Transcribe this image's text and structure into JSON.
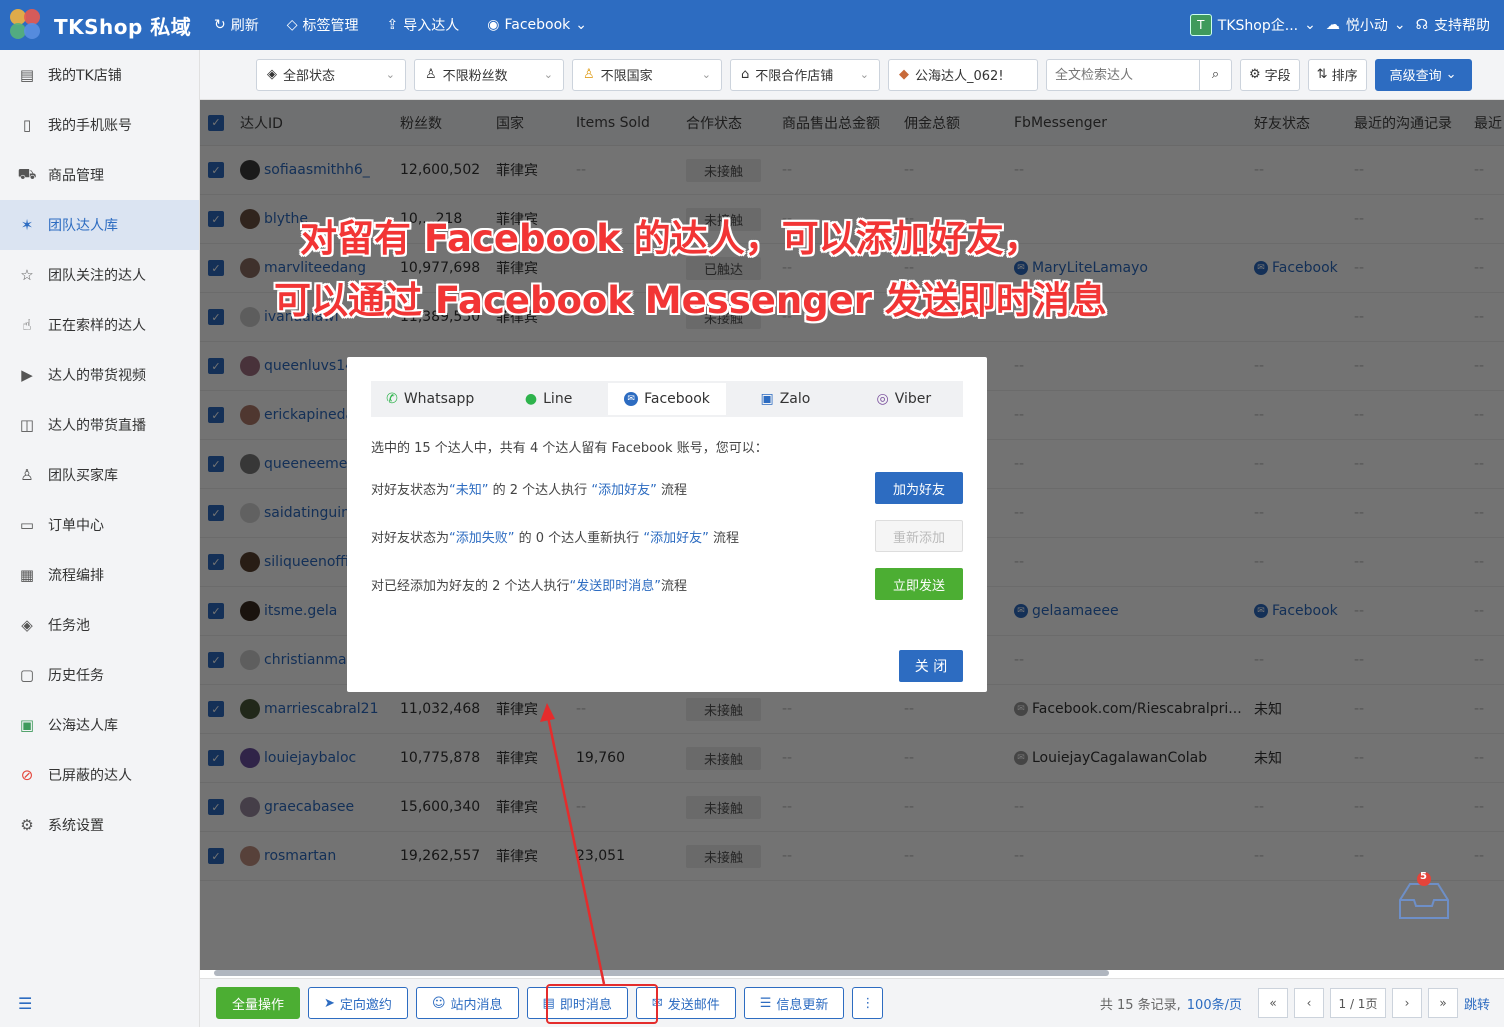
{
  "topbar": {
    "brand": "TKShop 私域",
    "nav": [
      "刷新",
      "标签管理",
      "导入达人",
      "Facebook"
    ],
    "company": "TKShop企...",
    "user": "悦小动",
    "help": "支持帮助",
    "company_initial": "T"
  },
  "sidebar": {
    "items": [
      {
        "label": "我的TK店铺",
        "icon": "shop-icon"
      },
      {
        "label": "我的手机账号",
        "icon": "phone-icon"
      },
      {
        "label": "商品管理",
        "icon": "cart-icon"
      },
      {
        "label": "团队达人库",
        "icon": "star-people-icon"
      },
      {
        "label": "团队关注的达人",
        "icon": "star-icon"
      },
      {
        "label": "正在索样的达人",
        "icon": "hand-icon"
      },
      {
        "label": "达人的带货视频",
        "icon": "video-icon"
      },
      {
        "label": "达人的带货直播",
        "icon": "live-icon"
      },
      {
        "label": "团队买家库",
        "icon": "buyer-icon"
      },
      {
        "label": "订单中心",
        "icon": "order-icon"
      },
      {
        "label": "流程编排",
        "icon": "calendar-icon"
      },
      {
        "label": "任务池",
        "icon": "layers-icon"
      },
      {
        "label": "历史任务",
        "icon": "clipboard-icon"
      },
      {
        "label": "公海达人库",
        "icon": "public-icon"
      },
      {
        "label": "已屏蔽的达人",
        "icon": "block-icon"
      },
      {
        "label": "系统设置",
        "icon": "gear-icon"
      }
    ],
    "active_index": 3
  },
  "filters": {
    "status": "全部状态",
    "fans": "不限粉丝数",
    "country": "不限国家",
    "shop": "不限合作店铺",
    "pool": "公海达人_062!",
    "search_placeholder": "全文检索达人",
    "fields": "字段",
    "sort": "排序",
    "advanced": "高级查询"
  },
  "table": {
    "headers": [
      "达人ID",
      "粉丝数",
      "国家",
      "Items Sold",
      "合作状态",
      "商品售出总金额",
      "佣金总额",
      "FbMessenger",
      "好友状态",
      "最近的沟通记录",
      "最近"
    ],
    "rows": [
      {
        "id": "sofiaasmithh6_",
        "fans": "12,600,502",
        "country": "菲律宾",
        "sold": "--",
        "status": "未接触",
        "fb": "--",
        "friend": "--"
      },
      {
        "id": "blythe",
        "fans": "10,...218",
        "country": "菲律宾",
        "sold": "",
        "status": "未接触",
        "fb": "",
        "friend": ""
      },
      {
        "id": "marvliteedang",
        "fans": "10,977,698",
        "country": "菲律宾",
        "sold": "",
        "status": "已触达",
        "fb": "MaryLiteLamayo",
        "friend": "Facebook",
        "fbicon": "blue",
        "friendicon": "blue"
      },
      {
        "id": "ivanaalawi",
        "fans": "11,389,550",
        "country": "菲律宾",
        "sold": "",
        "status": "未接触",
        "fb": "",
        "friend": ""
      },
      {
        "id": "queenluvs14",
        "fans": "",
        "country": "",
        "sold": "",
        "status": "",
        "fb": "--",
        "friend": "--"
      },
      {
        "id": "erickapineda",
        "fans": "",
        "country": "",
        "sold": "",
        "status": "",
        "fb": "--",
        "friend": "--"
      },
      {
        "id": "queeneemer",
        "fans": "",
        "country": "",
        "sold": "",
        "status": "",
        "fb": "--",
        "friend": "--"
      },
      {
        "id": "saidatinguin",
        "fans": "",
        "country": "",
        "sold": "",
        "status": "",
        "fb": "--",
        "friend": "--"
      },
      {
        "id": "siliqueenoffi",
        "fans": "",
        "country": "",
        "sold": "",
        "status": "",
        "fb": "--",
        "friend": "--"
      },
      {
        "id": "itsme.gela",
        "fans": "",
        "country": "",
        "sold": "",
        "status": "",
        "fb": "gelaamaeee",
        "friend": "Facebook",
        "fbicon": "blue",
        "friendicon": "blue"
      },
      {
        "id": "christianmae",
        "fans": "",
        "country": "",
        "sold": "",
        "status": "",
        "fb": "--",
        "friend": "--"
      },
      {
        "id": "marriescabral21",
        "fans": "11,032,468",
        "country": "菲律宾",
        "sold": "--",
        "status": "未接触",
        "fb": "Facebook.com/Riescabralpri...",
        "friend": "未知",
        "fbicon": "grey"
      },
      {
        "id": "louiejaybaloc",
        "fans": "10,775,878",
        "country": "菲律宾",
        "sold": "19,760",
        "status": "未接触",
        "fb": "LouiejayCagalawanColab",
        "friend": "未知",
        "fbicon": "grey"
      },
      {
        "id": "graecabasee",
        "fans": "15,600,340",
        "country": "菲律宾",
        "sold": "--",
        "status": "未接触",
        "fb": "--",
        "friend": "--"
      },
      {
        "id": "rosmartan",
        "fans": "19,262,557",
        "country": "菲律宾",
        "sold": "23,051",
        "status": "未接触",
        "fb": "--",
        "friend": "--"
      }
    ]
  },
  "annotation": {
    "line1": "对留有 Facebook 的达人，可以添加好友，",
    "line2": "可以通过 Facebook Messenger 发送即时消息"
  },
  "modal": {
    "tabs": [
      "Whatsapp",
      "Line",
      "Facebook",
      "Zalo",
      "Viber"
    ],
    "active_tab": 2,
    "intro": "选中的 15 个达人中，共有 4 个达人留有 Facebook 账号，您可以：",
    "row1": {
      "a": "对好友状态为",
      "b": "“未知”",
      "c": "的 2 个达人执行",
      "d": "“添加好友”",
      "e": "流程",
      "btn": "加为好友"
    },
    "row2": {
      "a": "对好友状态为",
      "b": "“添加失败”",
      "c": "的 0 个达人重新执行",
      "d": "“添加好友”",
      "e": "流程",
      "btn": "重新添加"
    },
    "row3": {
      "a": "对已经添加为好友的 2 个达人执行",
      "b": "“发送即时消息”",
      "c": "流程",
      "btn": "立即发送"
    },
    "close": "关 闭"
  },
  "bottombar": {
    "buttons": [
      "全量操作",
      "定向邀约",
      "站内消息",
      "即时消息",
      "发送邮件",
      "信息更新"
    ],
    "more": "⋮",
    "total": "共 15 条记录,",
    "per_page": "100条/页",
    "page": "1 / 1页",
    "jump": "跳转"
  },
  "badge_count": "5",
  "colors": {
    "primary": "#2d6cc1",
    "green": "#4cae33",
    "annotation": "#f23535"
  }
}
